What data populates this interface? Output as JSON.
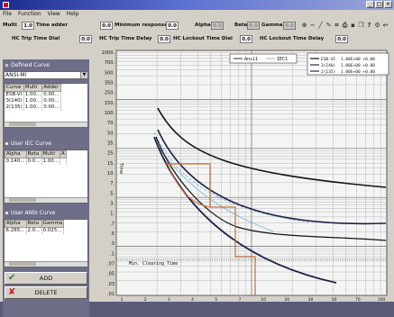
{
  "menu": [
    "File",
    "Function",
    "View",
    "Help"
  ],
  "params_row1": [
    {
      "label": "Multi",
      "value": "1.0"
    },
    {
      "label": "Time adder",
      "value": "0.0"
    },
    {
      "label": "Minimum response",
      "value": "0.0"
    },
    {
      "label": "Alpha",
      "value": "0.0"
    },
    {
      "label": "Beta",
      "value": "0.0"
    },
    {
      "label": "Gamma",
      "value": "0.0"
    }
  ],
  "params_row2": [
    {
      "label": "HC Trip Time Dial",
      "value": "0.0"
    },
    {
      "label": "HC Trip Time Delay",
      "value": "0.0"
    },
    {
      "label": "HC Lockout Time Dial",
      "value": "0.0"
    },
    {
      "label": "HC Lockout Time Delay",
      "value": "0.0"
    }
  ],
  "defined_curve": {
    "label": "Defined Curve",
    "combo_value": "ANSI-MI",
    "columns": [
      "Curve",
      "Multi",
      "Adder"
    ],
    "rows": [
      [
        "ESB-VI",
        "1.00...",
        "0.00..."
      ],
      [
        "3(140)",
        "1.00...",
        "0.00..."
      ],
      [
        "2(135)",
        "1.00...",
        "0.00..."
      ]
    ]
  },
  "iec_curve": {
    "label": "User IEC Curve",
    "columns": [
      "Alpha",
      "Beta",
      "Multi",
      "A"
    ],
    "rows": [
      [
        "0.140...",
        "0.0...",
        "1.00...",
        ""
      ]
    ]
  },
  "ansi_curve": {
    "label": "User ANSI Curve",
    "columns": [
      "Alpha",
      "Beta",
      "Gamma"
    ],
    "rows": [
      [
        "6.285...",
        "2.0...",
        "0.025..."
      ]
    ]
  },
  "buttons": {
    "add": "ADD",
    "delete": "DELETE"
  },
  "chart_data": {
    "type": "line",
    "yscale": "log",
    "xscale": "log",
    "y_tick_labels": [
      "1000.",
      "700.",
      "500.",
      "350.",
      "250.",
      "150.",
      "100.",
      "70.",
      "50.",
      "35.",
      "25.",
      "15.",
      "10.",
      "7.",
      "5.",
      "3.",
      "1.",
      ".7",
      ".5",
      ".3",
      ".1",
      ".07",
      ".05",
      ".03",
      ".01"
    ],
    "x_tick_labels": [
      "1",
      "2",
      "3",
      "4",
      "5",
      "7",
      "10",
      "20",
      "30",
      "50",
      "70",
      "100"
    ],
    "ylabel": "Time",
    "annotation": "Min. Clearing Time",
    "legend_left": [
      "Ansi1",
      "IEC1"
    ],
    "legend_right": [
      "ESB-VI",
      "3(140)",
      "2(135)"
    ],
    "legend_right_values": [
      "1.00E+00 +0.00",
      "1.00E+00 +0.00",
      "1.00E+00 +0.00"
    ],
    "colors": {
      "black": "#111111",
      "cyan": "#7fb8d0",
      "orange": "#c4703a",
      "navy": "#23234a"
    }
  }
}
